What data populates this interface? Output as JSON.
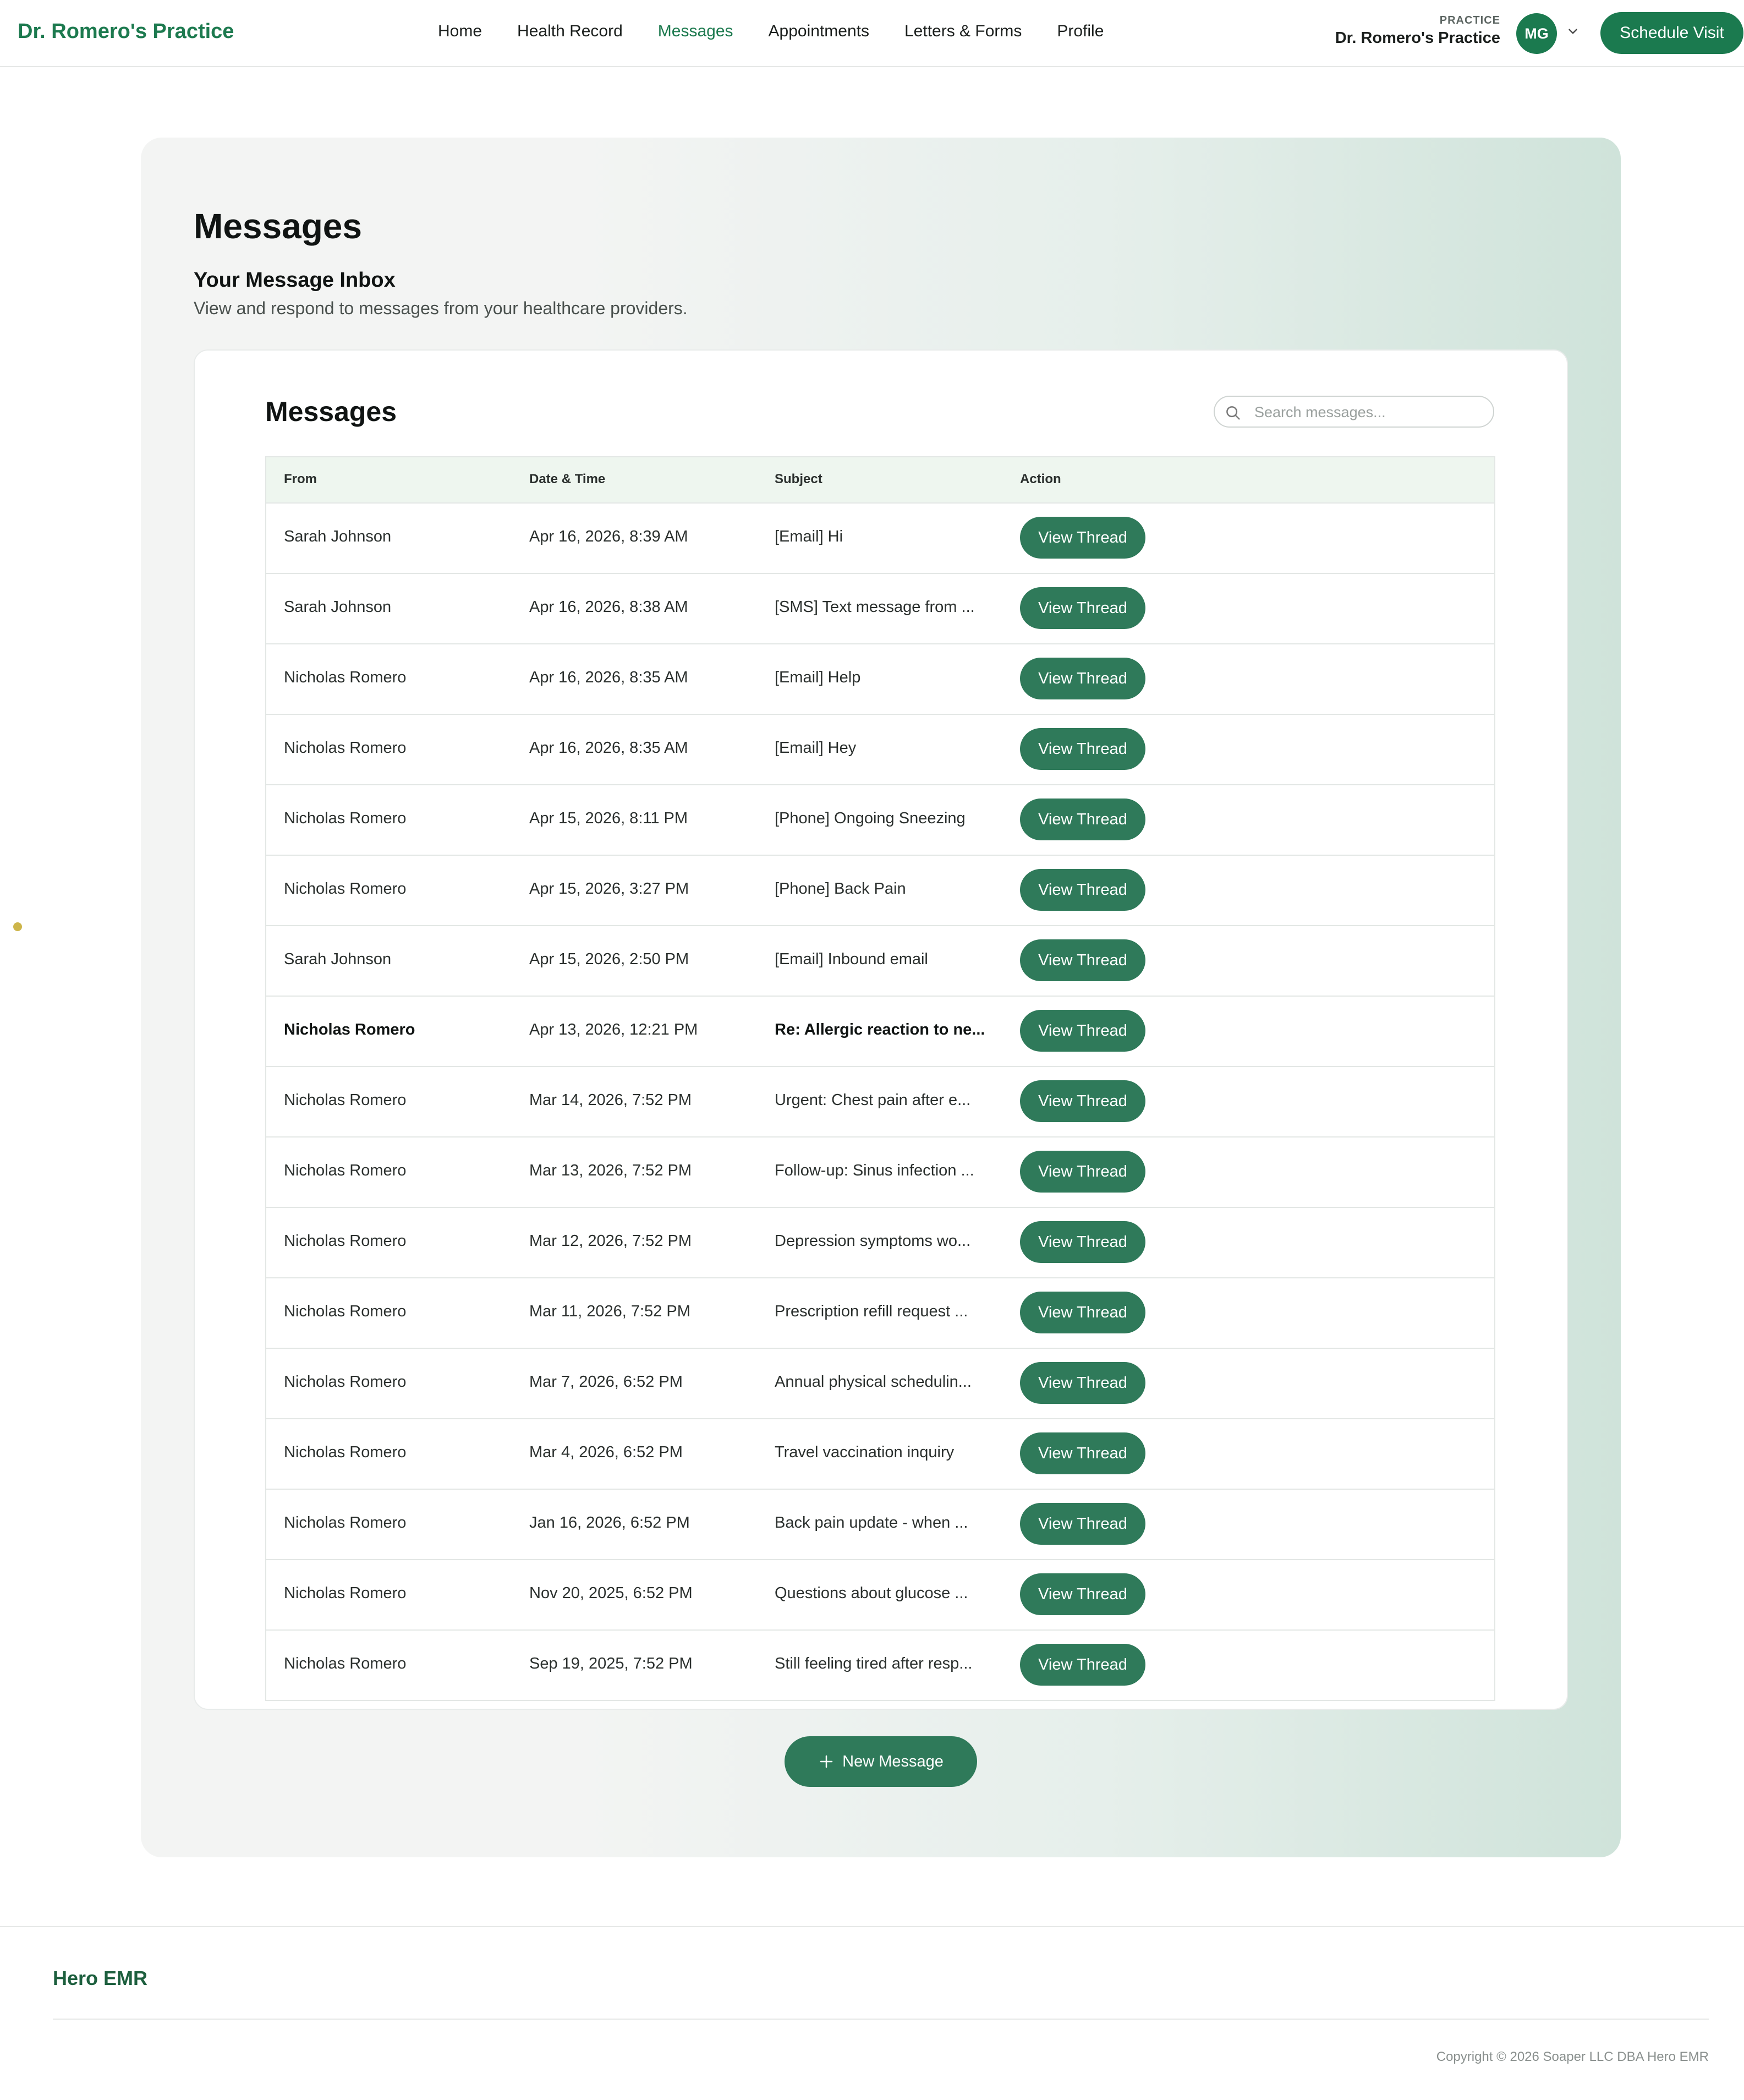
{
  "header": {
    "brand": "Dr. Romero's Practice",
    "nav": [
      {
        "label": "Home",
        "active": false
      },
      {
        "label": "Health Record",
        "active": false
      },
      {
        "label": "Messages",
        "active": true
      },
      {
        "label": "Appointments",
        "active": false
      },
      {
        "label": "Letters & Forms",
        "active": false
      },
      {
        "label": "Profile",
        "active": false
      }
    ],
    "practice_label": "PRACTICE",
    "practice_name": "Dr. Romero's Practice",
    "avatar_initials": "MG",
    "schedule_label": "Schedule Visit"
  },
  "hero": {
    "title": "Messages",
    "subtitle": "Your Message Inbox",
    "description": "View and respond to messages from your healthcare providers."
  },
  "messages_card": {
    "title": "Messages",
    "search_placeholder": "Search messages...",
    "columns": [
      "From",
      "Date & Time",
      "Subject",
      "Action"
    ],
    "action_label": "View Thread",
    "rows": [
      {
        "from": "Sarah Johnson",
        "date": "Apr 16, 2026, 8:39 AM",
        "subject": "[Email] Hi",
        "unread": false
      },
      {
        "from": "Sarah Johnson",
        "date": "Apr 16, 2026, 8:38 AM",
        "subject": "[SMS] Text message from ...",
        "unread": false
      },
      {
        "from": "Nicholas Romero",
        "date": "Apr 16, 2026, 8:35 AM",
        "subject": "[Email] Help",
        "unread": false
      },
      {
        "from": "Nicholas Romero",
        "date": "Apr 16, 2026, 8:35 AM",
        "subject": "[Email] Hey",
        "unread": false
      },
      {
        "from": "Nicholas Romero",
        "date": "Apr 15, 2026, 8:11 PM",
        "subject": "[Phone] Ongoing Sneezing",
        "unread": false
      },
      {
        "from": "Nicholas Romero",
        "date": "Apr 15, 2026, 3:27 PM",
        "subject": "[Phone] Back Pain",
        "unread": false
      },
      {
        "from": "Sarah Johnson",
        "date": "Apr 15, 2026, 2:50 PM",
        "subject": "[Email] Inbound email",
        "unread": false
      },
      {
        "from": "Nicholas Romero",
        "date": "Apr 13, 2026, 12:21 PM",
        "subject": "Re: Allergic reaction to ne...",
        "unread": true
      },
      {
        "from": "Nicholas Romero",
        "date": "Mar 14, 2026, 7:52 PM",
        "subject": "Urgent: Chest pain after e...",
        "unread": false
      },
      {
        "from": "Nicholas Romero",
        "date": "Mar 13, 2026, 7:52 PM",
        "subject": "Follow-up: Sinus infection ...",
        "unread": false
      },
      {
        "from": "Nicholas Romero",
        "date": "Mar 12, 2026, 7:52 PM",
        "subject": "Depression symptoms wo...",
        "unread": false
      },
      {
        "from": "Nicholas Romero",
        "date": "Mar 11, 2026, 7:52 PM",
        "subject": "Prescription refill request ...",
        "unread": false
      },
      {
        "from": "Nicholas Romero",
        "date": "Mar 7, 2026, 6:52 PM",
        "subject": "Annual physical schedulin...",
        "unread": false
      },
      {
        "from": "Nicholas Romero",
        "date": "Mar 4, 2026, 6:52 PM",
        "subject": "Travel vaccination inquiry",
        "unread": false
      },
      {
        "from": "Nicholas Romero",
        "date": "Jan 16, 2026, 6:52 PM",
        "subject": "Back pain update - when ...",
        "unread": false
      },
      {
        "from": "Nicholas Romero",
        "date": "Nov 20, 2025, 6:52 PM",
        "subject": "Questions about glucose ...",
        "unread": false
      },
      {
        "from": "Nicholas Romero",
        "date": "Sep 19, 2025, 7:52 PM",
        "subject": "Still feeling tired after resp...",
        "unread": false
      }
    ]
  },
  "new_message_label": "New Message",
  "footer": {
    "brand": "Hero EMR",
    "copyright": "Copyright © 2026 Soaper LLC DBA Hero EMR"
  },
  "colors": {
    "brand_green": "#1d7a4f",
    "button_green": "#2f7a5a",
    "table_header_bg": "#eef6ef"
  }
}
